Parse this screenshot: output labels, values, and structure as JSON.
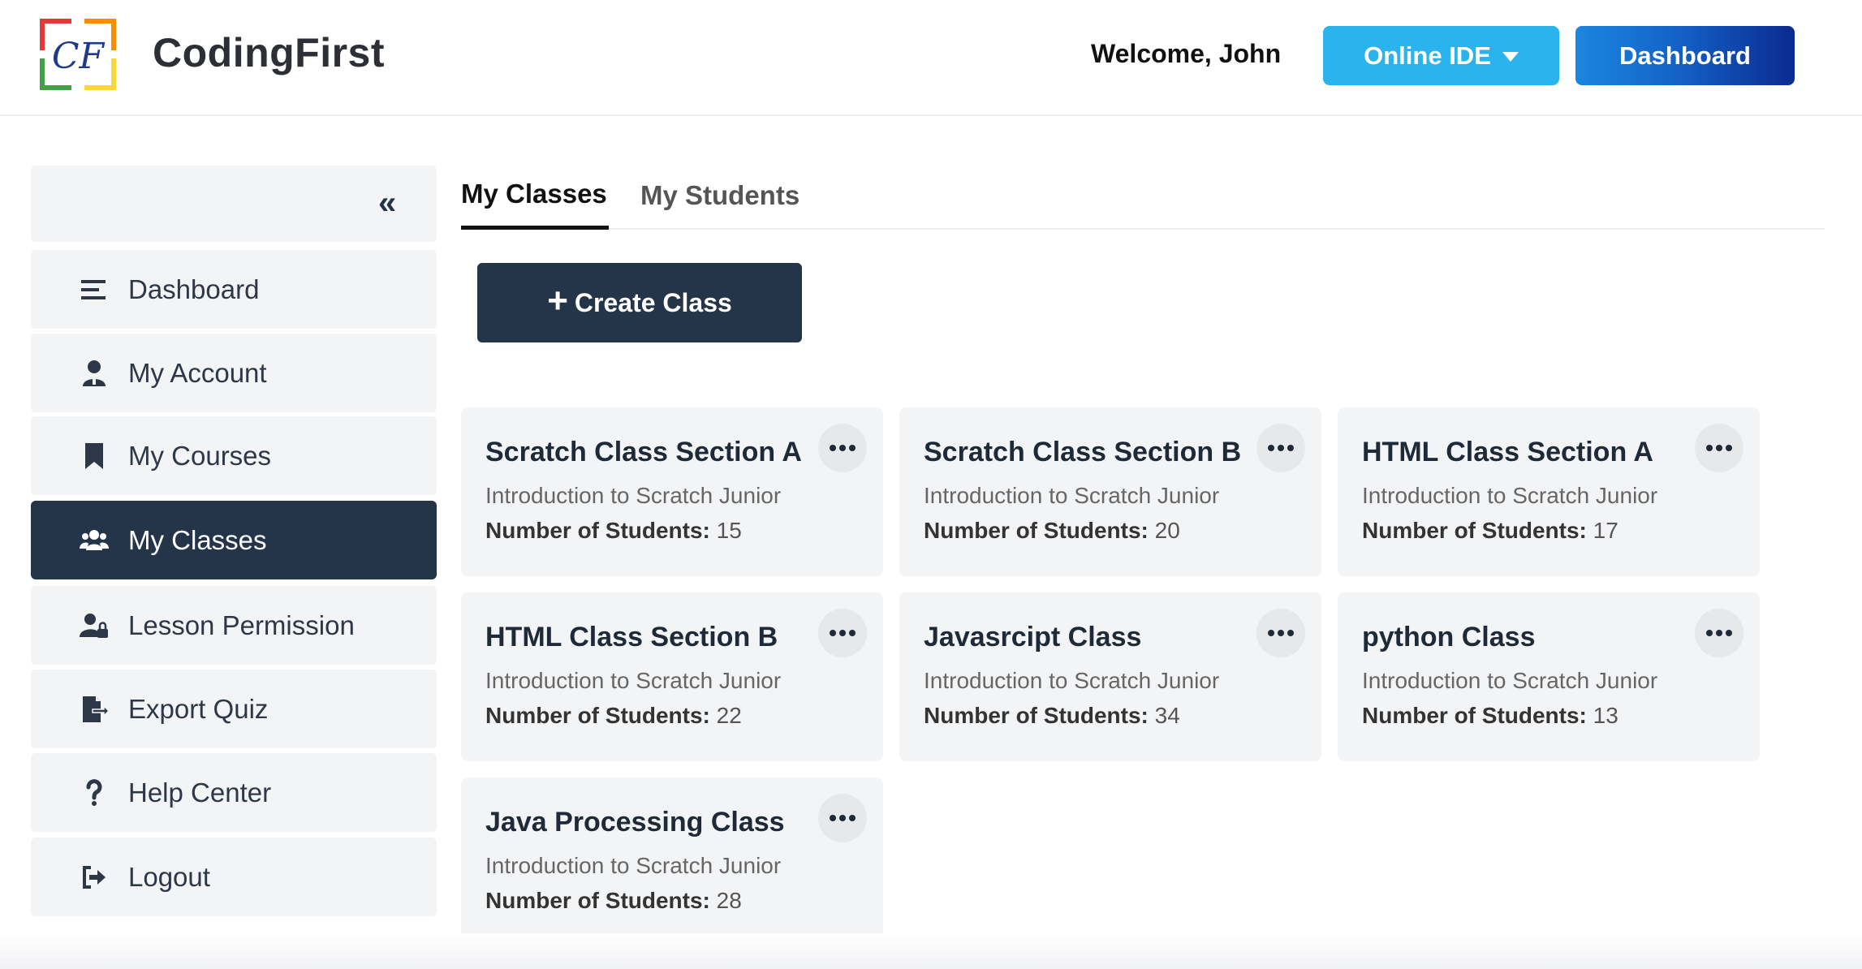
{
  "header": {
    "brand": "CodingFirst",
    "logo_text": "CF",
    "welcome": "Welcome, John",
    "online_ide_label": "Online IDE",
    "dashboard_label": "Dashboard"
  },
  "sidebar": {
    "collapse_icon": "double-chevron-left-icon",
    "items": [
      {
        "label": "Dashboard",
        "icon": "list-icon"
      },
      {
        "label": "My Account",
        "icon": "user-icon"
      },
      {
        "label": "My Courses",
        "icon": "bookmark-icon"
      },
      {
        "label": "My Classes",
        "icon": "users-icon",
        "active": true
      },
      {
        "label": "Lesson Permission",
        "icon": "user-lock-icon"
      },
      {
        "label": "Export Quiz",
        "icon": "file-export-icon"
      },
      {
        "label": "Help Center",
        "icon": "question-icon"
      },
      {
        "label": "Logout",
        "icon": "logout-icon"
      }
    ]
  },
  "tabs": [
    {
      "label": "My Classes",
      "active": true
    },
    {
      "label": "My Students",
      "active": false
    }
  ],
  "create_class_label": "Create Class",
  "count_label": "Number of Students:",
  "classes": [
    {
      "title": "Scratch Class Section A",
      "course": "Introduction to Scratch Junior",
      "students": "15"
    },
    {
      "title": "Scratch Class Section B",
      "course": "Introduction to Scratch Junior",
      "students": "20"
    },
    {
      "title": "HTML Class Section A",
      "course": "Introduction to Scratch Junior",
      "students": "17"
    },
    {
      "title": "HTML Class Section B",
      "course": "Introduction to Scratch Junior",
      "students": "22"
    },
    {
      "title": "Javasrcipt Class",
      "course": "Introduction to Scratch Junior",
      "students": "34"
    },
    {
      "title": "python Class",
      "course": "Introduction to Scratch Junior",
      "students": "13"
    },
    {
      "title": "Java Processing Class",
      "course": "Introduction to Scratch Junior",
      "students": "28"
    }
  ],
  "colors": {
    "navy": "#24354a",
    "ide_blue": "#2bb3ee",
    "card_bg": "#f3f4f6"
  }
}
